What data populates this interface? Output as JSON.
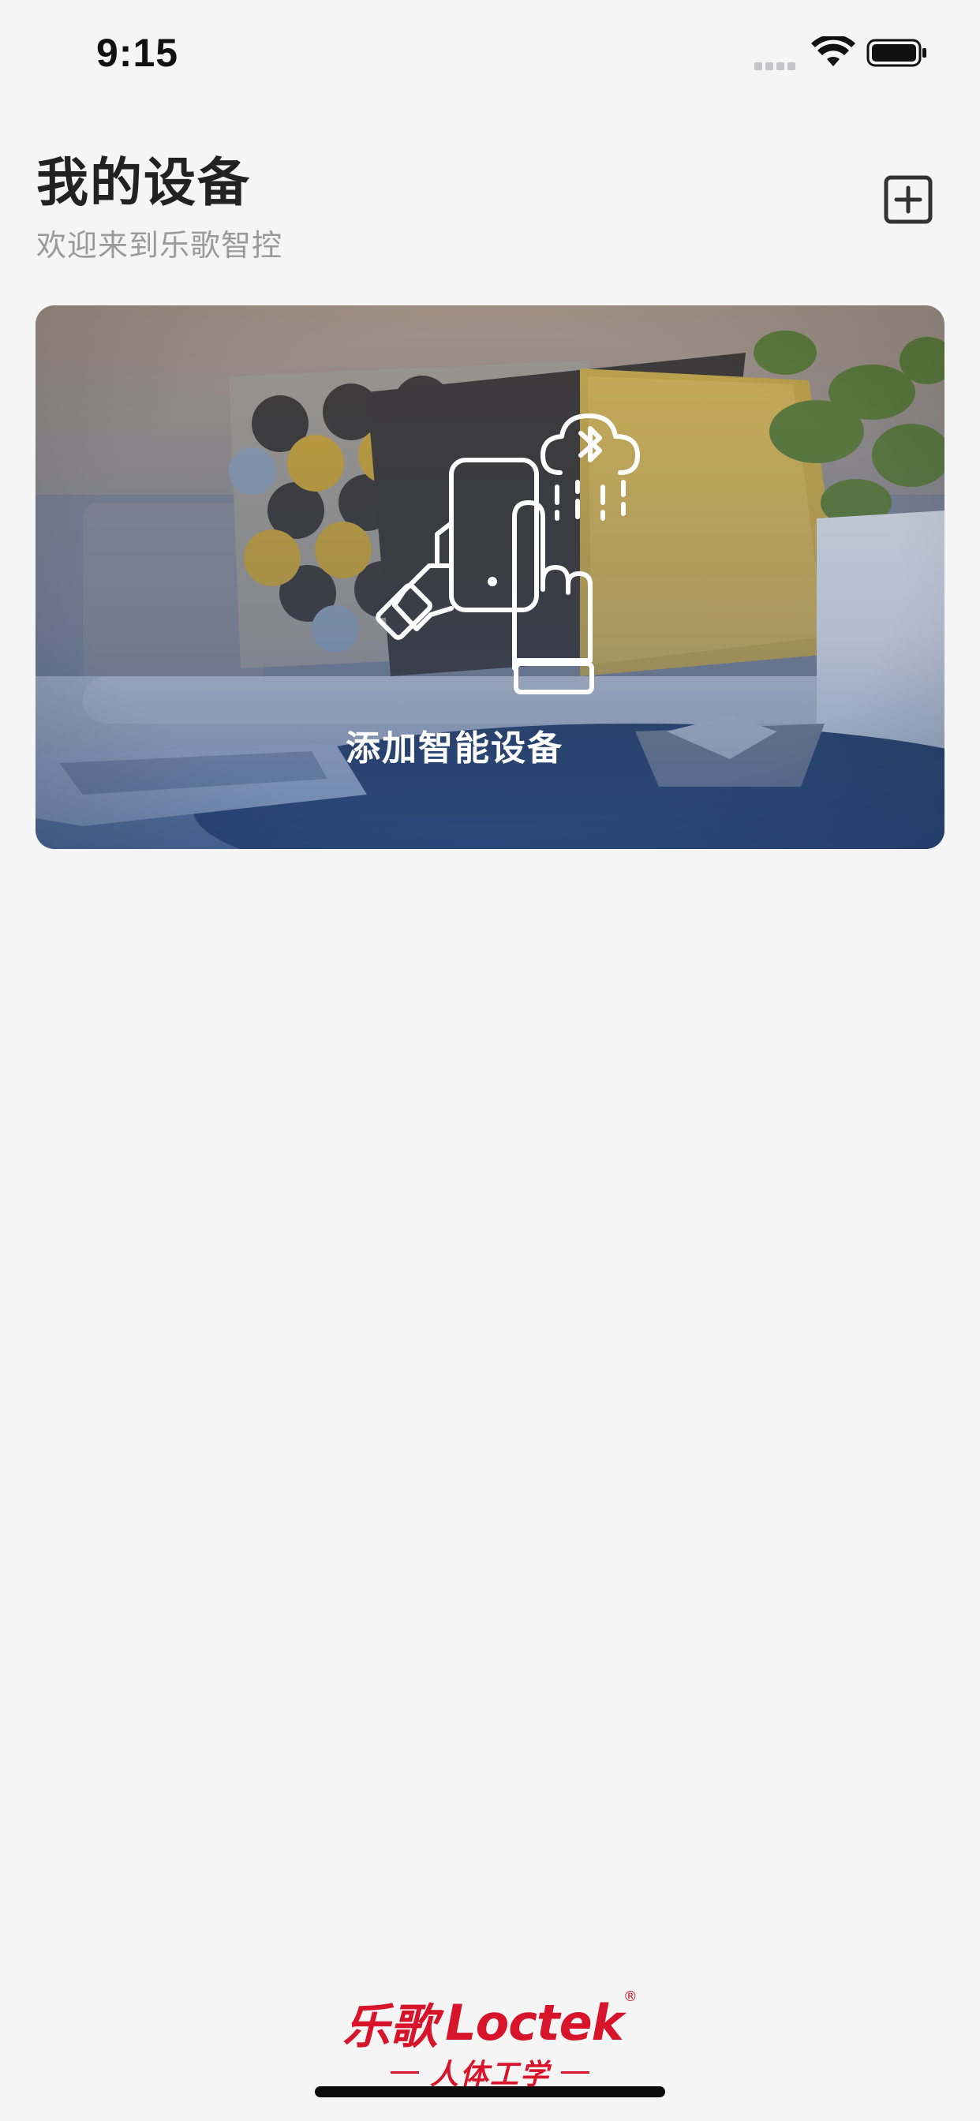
{
  "status_bar": {
    "time": "9:15"
  },
  "header": {
    "title": "我的设备",
    "subtitle": "欢迎来到乐歌智控",
    "add_icon": "plus-square-icon"
  },
  "card": {
    "label": "添加智能设备",
    "icon": "phone-tap-bluetooth-icon"
  },
  "brand": {
    "name_cn": "乐歌",
    "name_en": "Loctek",
    "registered": "®",
    "slogan": "人体工学"
  },
  "colors": {
    "background": "#f5f5f6",
    "brand_red": "#d8142b",
    "title": "#222222",
    "subtitle": "#9a9a9a"
  }
}
